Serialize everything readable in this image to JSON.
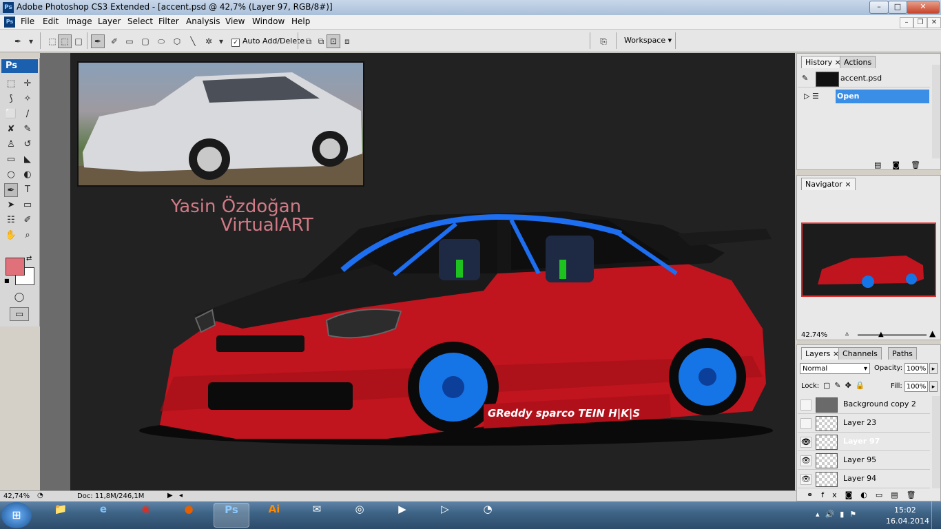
{
  "window": {
    "title": "Adobe Photoshop CS3 Extended - [accent.psd @ 42,7% (Layer 97, RGB/8#)]",
    "app_badge": "Ps",
    "minimize": "–",
    "maximize": "□",
    "close": "✕"
  },
  "menu": {
    "items": [
      "File",
      "Edit",
      "Image",
      "Layer",
      "Select",
      "Filter",
      "Analysis",
      "View",
      "Window",
      "Help"
    ],
    "doc_controls": [
      "–",
      "❐",
      "✕"
    ]
  },
  "options_bar": {
    "auto_add_label": "Auto Add/Delete",
    "auto_add_checked": "✓",
    "workspace_label": "Workspace ▾"
  },
  "toolbox": {
    "badge": "Ps",
    "tools": [
      {
        "name": "marquee-tool-icon",
        "glyph": "⬚"
      },
      {
        "name": "move-tool-icon",
        "glyph": "✛"
      },
      {
        "name": "lasso-tool-icon",
        "glyph": "⟆"
      },
      {
        "name": "magic-wand-icon",
        "glyph": "✧"
      },
      {
        "name": "crop-tool-icon",
        "glyph": "⬜"
      },
      {
        "name": "slice-tool-icon",
        "glyph": "∕"
      },
      {
        "name": "healing-brush-icon",
        "glyph": "✘"
      },
      {
        "name": "brush-tool-icon",
        "glyph": "✎"
      },
      {
        "name": "clone-stamp-icon",
        "glyph": "♙"
      },
      {
        "name": "history-brush-icon",
        "glyph": "↺"
      },
      {
        "name": "eraser-tool-icon",
        "glyph": "▭"
      },
      {
        "name": "paint-bucket-icon",
        "glyph": "◣"
      },
      {
        "name": "blur-tool-icon",
        "glyph": "○"
      },
      {
        "name": "dodge-tool-icon",
        "glyph": "◐"
      },
      {
        "name": "pen-tool-icon",
        "glyph": "✒"
      },
      {
        "name": "type-tool-icon",
        "glyph": "T"
      },
      {
        "name": "path-selection-icon",
        "glyph": "➤"
      },
      {
        "name": "shape-tool-icon",
        "glyph": "▭"
      },
      {
        "name": "notes-tool-icon",
        "glyph": "☷"
      },
      {
        "name": "eyedropper-icon",
        "glyph": "✐"
      },
      {
        "name": "hand-tool-icon",
        "glyph": "✋"
      },
      {
        "name": "zoom-tool-icon",
        "glyph": "⌕"
      }
    ],
    "foreground_color": "#e0707a",
    "background_color": "#ffffff"
  },
  "canvas": {
    "author_line1": "Yasin Özdoğan",
    "author_line2": "VirtualART",
    "decal_text": "GReddy  sparco  TEIN  H|K|S"
  },
  "status_bar": {
    "zoom": "42,74%",
    "doc_info": "Doc: 11,8M/246,1M"
  },
  "history_panel": {
    "tabs": [
      "History",
      "Actions"
    ],
    "snapshot_name": "accent.psd",
    "steps": [
      "Open"
    ]
  },
  "navigator_panel": {
    "tab": "Navigator",
    "zoom": "42.74%"
  },
  "layers_panel": {
    "tabs": [
      "Layers",
      "Channels",
      "Paths"
    ],
    "blend_mode": "Normal",
    "opacity_label": "Opacity:",
    "opacity_value": "100%",
    "lock_label": "Lock:",
    "fill_label": "Fill:",
    "fill_value": "100%",
    "layers": [
      {
        "name": "Background copy 2",
        "visible": false,
        "selected": false
      },
      {
        "name": "Layer 23",
        "visible": false,
        "selected": false
      },
      {
        "name": "Layer 97",
        "visible": true,
        "selected": true
      },
      {
        "name": "Layer 95",
        "visible": true,
        "selected": false
      },
      {
        "name": "Layer 94",
        "visible": true,
        "selected": false
      }
    ]
  },
  "taskbar": {
    "apps": [
      {
        "name": "explorer",
        "glyph": "📁",
        "active": false
      },
      {
        "name": "internet-explorer",
        "glyph": "e",
        "active": false
      },
      {
        "name": "chrome",
        "glyph": "◉",
        "active": false
      },
      {
        "name": "firefox",
        "glyph": "●",
        "active": false
      },
      {
        "name": "photoshop",
        "glyph": "Ps",
        "active": true
      },
      {
        "name": "illustrator",
        "glyph": "Ai",
        "active": false
      },
      {
        "name": "mail",
        "glyph": "✉",
        "active": false
      },
      {
        "name": "bittorrent",
        "glyph": "◎",
        "active": false
      },
      {
        "name": "media-player",
        "glyph": "▶",
        "active": false
      },
      {
        "name": "media-center",
        "glyph": "▷",
        "active": false
      },
      {
        "name": "misc-app",
        "glyph": "◔",
        "active": false
      }
    ],
    "time": "15:02",
    "date": "16.04.2014",
    "colors": {
      "photoshop": "#0b3c73",
      "illustrator": "#ff8a00",
      "chrome": "#d93025",
      "firefox": "#e66000",
      "ie": "#2a7fd4"
    }
  }
}
